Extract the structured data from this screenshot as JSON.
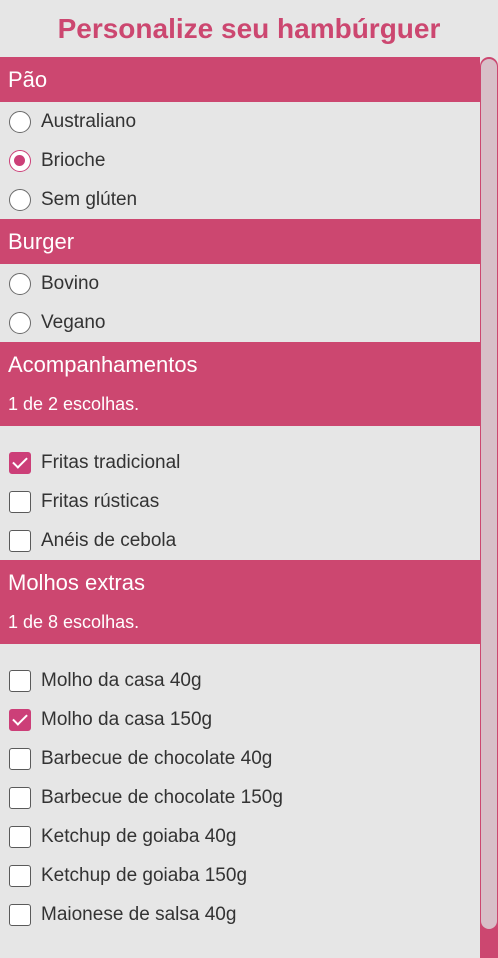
{
  "title": "Personalize seu hambúrguer",
  "colors": {
    "accent": "#cc4770",
    "control": "#cc3f78",
    "background": "#e6e6e6"
  },
  "sections": {
    "pao": {
      "title": "Pão",
      "options": [
        {
          "label": "Australiano",
          "selected": false
        },
        {
          "label": "Brioche",
          "selected": true
        },
        {
          "label": "Sem glúten",
          "selected": false
        }
      ]
    },
    "burger": {
      "title": "Burger",
      "options": [
        {
          "label": "Bovino",
          "selected": false
        },
        {
          "label": "Vegano",
          "selected": false
        }
      ]
    },
    "acompanhamentos": {
      "title": "Acompanhamentos",
      "subtitle": "1 de 2 escolhas.",
      "options": [
        {
          "label": "Fritas tradicional",
          "checked": true
        },
        {
          "label": "Fritas rústicas",
          "checked": false
        },
        {
          "label": "Anéis de cebola",
          "checked": false
        }
      ]
    },
    "molhos": {
      "title": "Molhos extras",
      "subtitle": "1 de 8 escolhas.",
      "options": [
        {
          "label": "Molho da casa 40g",
          "checked": false
        },
        {
          "label": "Molho da casa 150g",
          "checked": true
        },
        {
          "label": "Barbecue de chocolate 40g",
          "checked": false
        },
        {
          "label": "Barbecue de chocolate 150g",
          "checked": false
        },
        {
          "label": "Ketchup de goiaba 40g",
          "checked": false
        },
        {
          "label": "Ketchup de goiaba 150g",
          "checked": false
        },
        {
          "label": "Maionese de salsa 40g",
          "checked": false
        }
      ]
    }
  }
}
